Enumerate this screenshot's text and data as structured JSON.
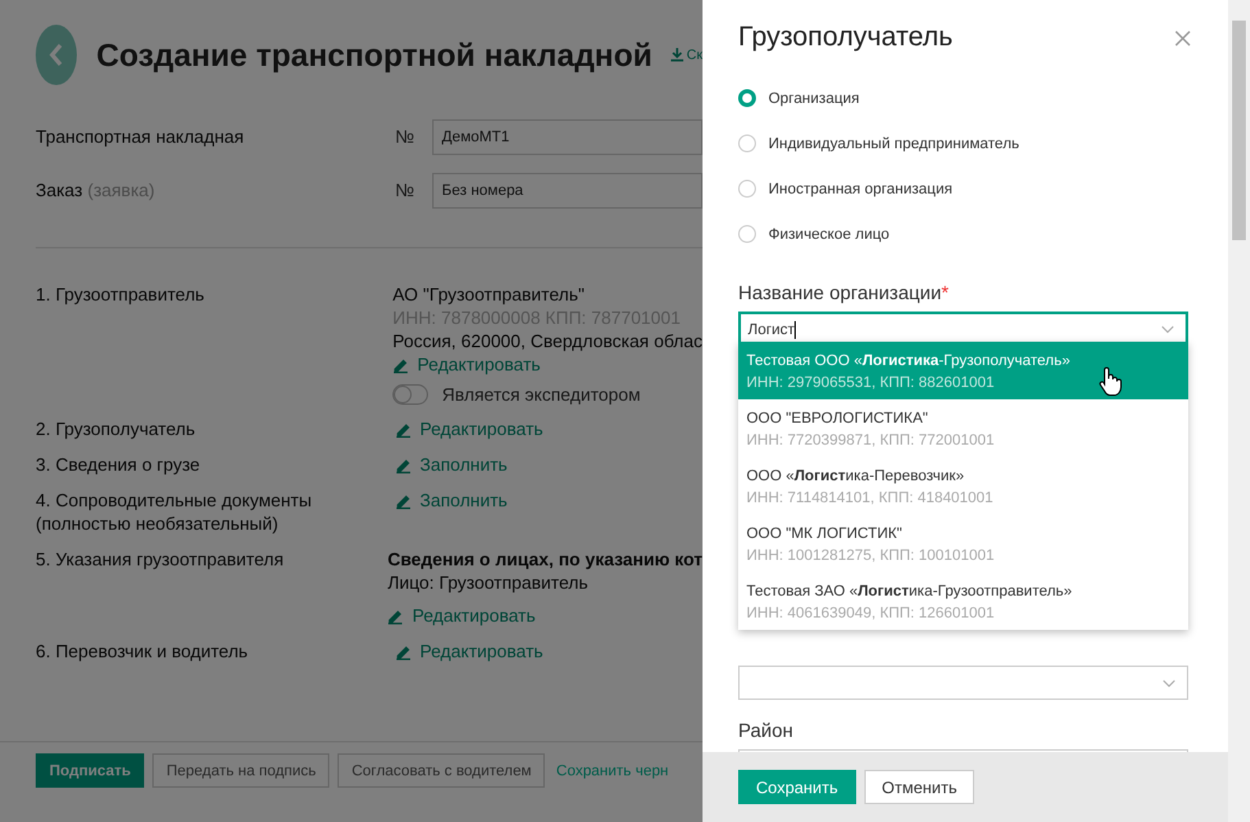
{
  "page": {
    "title": "Создание транспортной накладной",
    "download_link": "Ск",
    "header_fields": [
      {
        "label": "Транспортная накладная",
        "number_sign": "№",
        "value": "ДемоМТ1"
      },
      {
        "label": "Заказ",
        "hint": "(заявка)",
        "number_sign": "№",
        "value": "Без номера"
      }
    ],
    "sections": [
      {
        "label": "1. Грузоотправитель",
        "lines": [
          {
            "kind": "name",
            "text": "АО \"Грузоотправитель\""
          },
          {
            "kind": "muted",
            "text": "ИНН: 7878000008 КПП: 787701001"
          },
          {
            "kind": "plain",
            "text": "Россия, 620000, Свердловская облас"
          }
        ],
        "action": "Редактировать",
        "toggle": {
          "label": "Является экспедитором",
          "on": false
        }
      },
      {
        "label": "2. Грузополучатель",
        "action": "Редактировать"
      },
      {
        "label": "3. Сведения о грузе",
        "action": "Заполнить"
      },
      {
        "label": "4. Сопроводительные документы (полностью необязательный)",
        "action": "Заполнить"
      },
      {
        "label": "5. Указания грузоотправителя",
        "lines": [
          {
            "kind": "bold",
            "text": "Сведения о лицах, по указанию кот"
          },
          {
            "kind": "plain",
            "text": "Лицо: Грузоотправитель"
          }
        ],
        "action": "Редактировать"
      },
      {
        "label": "6. Перевозчик и водитель",
        "action": "Редактировать"
      }
    ],
    "footer_buttons": [
      {
        "label": "Подписать",
        "kind": "primary"
      },
      {
        "label": "Передать на подпись",
        "kind": "outline"
      },
      {
        "label": "Согласовать с водителем",
        "kind": "outline"
      },
      {
        "label": "Сохранить черн",
        "kind": "link"
      }
    ]
  },
  "dialog": {
    "title": "Грузополучатель",
    "types": [
      {
        "label": "Организация",
        "selected": true
      },
      {
        "label": "Индивидуальный предприниматель",
        "selected": false
      },
      {
        "label": "Иностранная организация",
        "selected": false
      },
      {
        "label": "Физическое лицо",
        "selected": false
      }
    ],
    "org_field": {
      "label": "Название организации",
      "required_mark": "*",
      "value": "Логист"
    },
    "suggestions": [
      {
        "name": "Тестовая ООО «**Логистика**-Грузополучатель»",
        "details": "ИНН: 2979065531, КПП: 882601001",
        "selected": true
      },
      {
        "name": "ООО \"ЕВРОЛОГИСТИКА\"",
        "details": "ИНН: 7720399871, КПП: 772001001",
        "selected": false
      },
      {
        "name": "ООО «**Логист**ика-Перевозчик»",
        "details": "ИНН: 7114814101, КПП: 418401001",
        "selected": false
      },
      {
        "name": "ООО \"МК ЛОГИСТИК\"",
        "details": "ИНН: 1001281275, КПП: 100101001",
        "selected": false
      },
      {
        "name": "Тестовая ЗАО «**Логист**ика-Грузоотправитель»",
        "details": "ИНН: 4061639049, КПП: 126601001",
        "selected": false
      }
    ],
    "district_label": "Район",
    "buttons": [
      {
        "label": "Сохранить",
        "kind": "primary"
      },
      {
        "label": "Отменить",
        "kind": "outline"
      }
    ]
  }
}
